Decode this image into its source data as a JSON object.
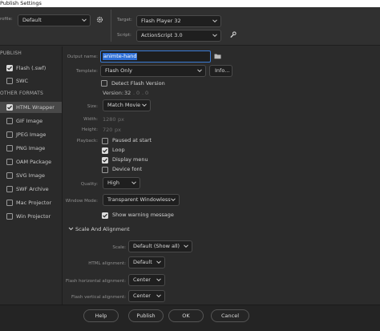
{
  "window": {
    "title": "Publish Settings"
  },
  "top": {
    "profile_label": "rofile:",
    "profile_value": "Default",
    "target_label": "Target:",
    "target_value": "Flash Player 32",
    "script_label": "Script:",
    "script_value": "ActionScript 3.0"
  },
  "sidebar": {
    "publish_heading": "PUBLISH",
    "publish_items": [
      {
        "label": "Flash (.swf)",
        "checked": true
      },
      {
        "label": "SWC",
        "checked": false
      }
    ],
    "other_heading": "OTHER FORMATS",
    "other_items": [
      {
        "label": "HTML Wrapper",
        "checked": true,
        "selected": true
      },
      {
        "label": "GIF Image",
        "checked": false
      },
      {
        "label": "JPEG Image",
        "checked": false
      },
      {
        "label": "PNG Image",
        "checked": false
      },
      {
        "label": "OAM Package",
        "checked": false
      },
      {
        "label": "SVG Image",
        "checked": false
      },
      {
        "label": "SWF Archive",
        "checked": false
      },
      {
        "label": "Mac Projector",
        "checked": false
      },
      {
        "label": "Win Projector",
        "checked": false
      }
    ]
  },
  "form": {
    "output_label": "Output name:",
    "output_value": "animte-hand",
    "template_label": "Template:",
    "template_value": "Flash Only",
    "info_button": "Info...",
    "detect_flash": "Detect Flash Version",
    "version_label": "Version:",
    "version_values": [
      "32",
      "0",
      "0"
    ],
    "size_label": "Size:",
    "size_value": "Match Movie",
    "width_label": "Width:",
    "width_value": "1280",
    "height_label": "Height:",
    "height_value": "720",
    "unit": "px",
    "playback_label": "Playback:",
    "playback_options": [
      {
        "label": "Paused at start",
        "checked": false
      },
      {
        "label": "Loop",
        "checked": true
      },
      {
        "label": "Display menu",
        "checked": true
      },
      {
        "label": "Device font",
        "checked": false
      }
    ],
    "quality_label": "Quality:",
    "quality_value": "High",
    "window_mode_label": "Window Mode:",
    "window_mode_value": "Transparent Windowless",
    "show_warning": "Show warning message",
    "scale_section": "Scale And Alignment",
    "scale_label": "Scale:",
    "scale_value": "Default (Show all)",
    "html_align_label": "HTML alignment:",
    "html_align_value": "Default",
    "flash_h_label": "Flash horizontal alignment:",
    "flash_h_value": "Center",
    "flash_v_label": "Flash vertical alignment:",
    "flash_v_value": "Center"
  },
  "buttons": {
    "help": "Help",
    "publish": "Publish",
    "ok": "OK",
    "cancel": "Cancel"
  },
  "colors": {
    "selection": "#2f6fd6",
    "panel": "#2b2b2b",
    "accent_focus": "#3a7bd5"
  }
}
